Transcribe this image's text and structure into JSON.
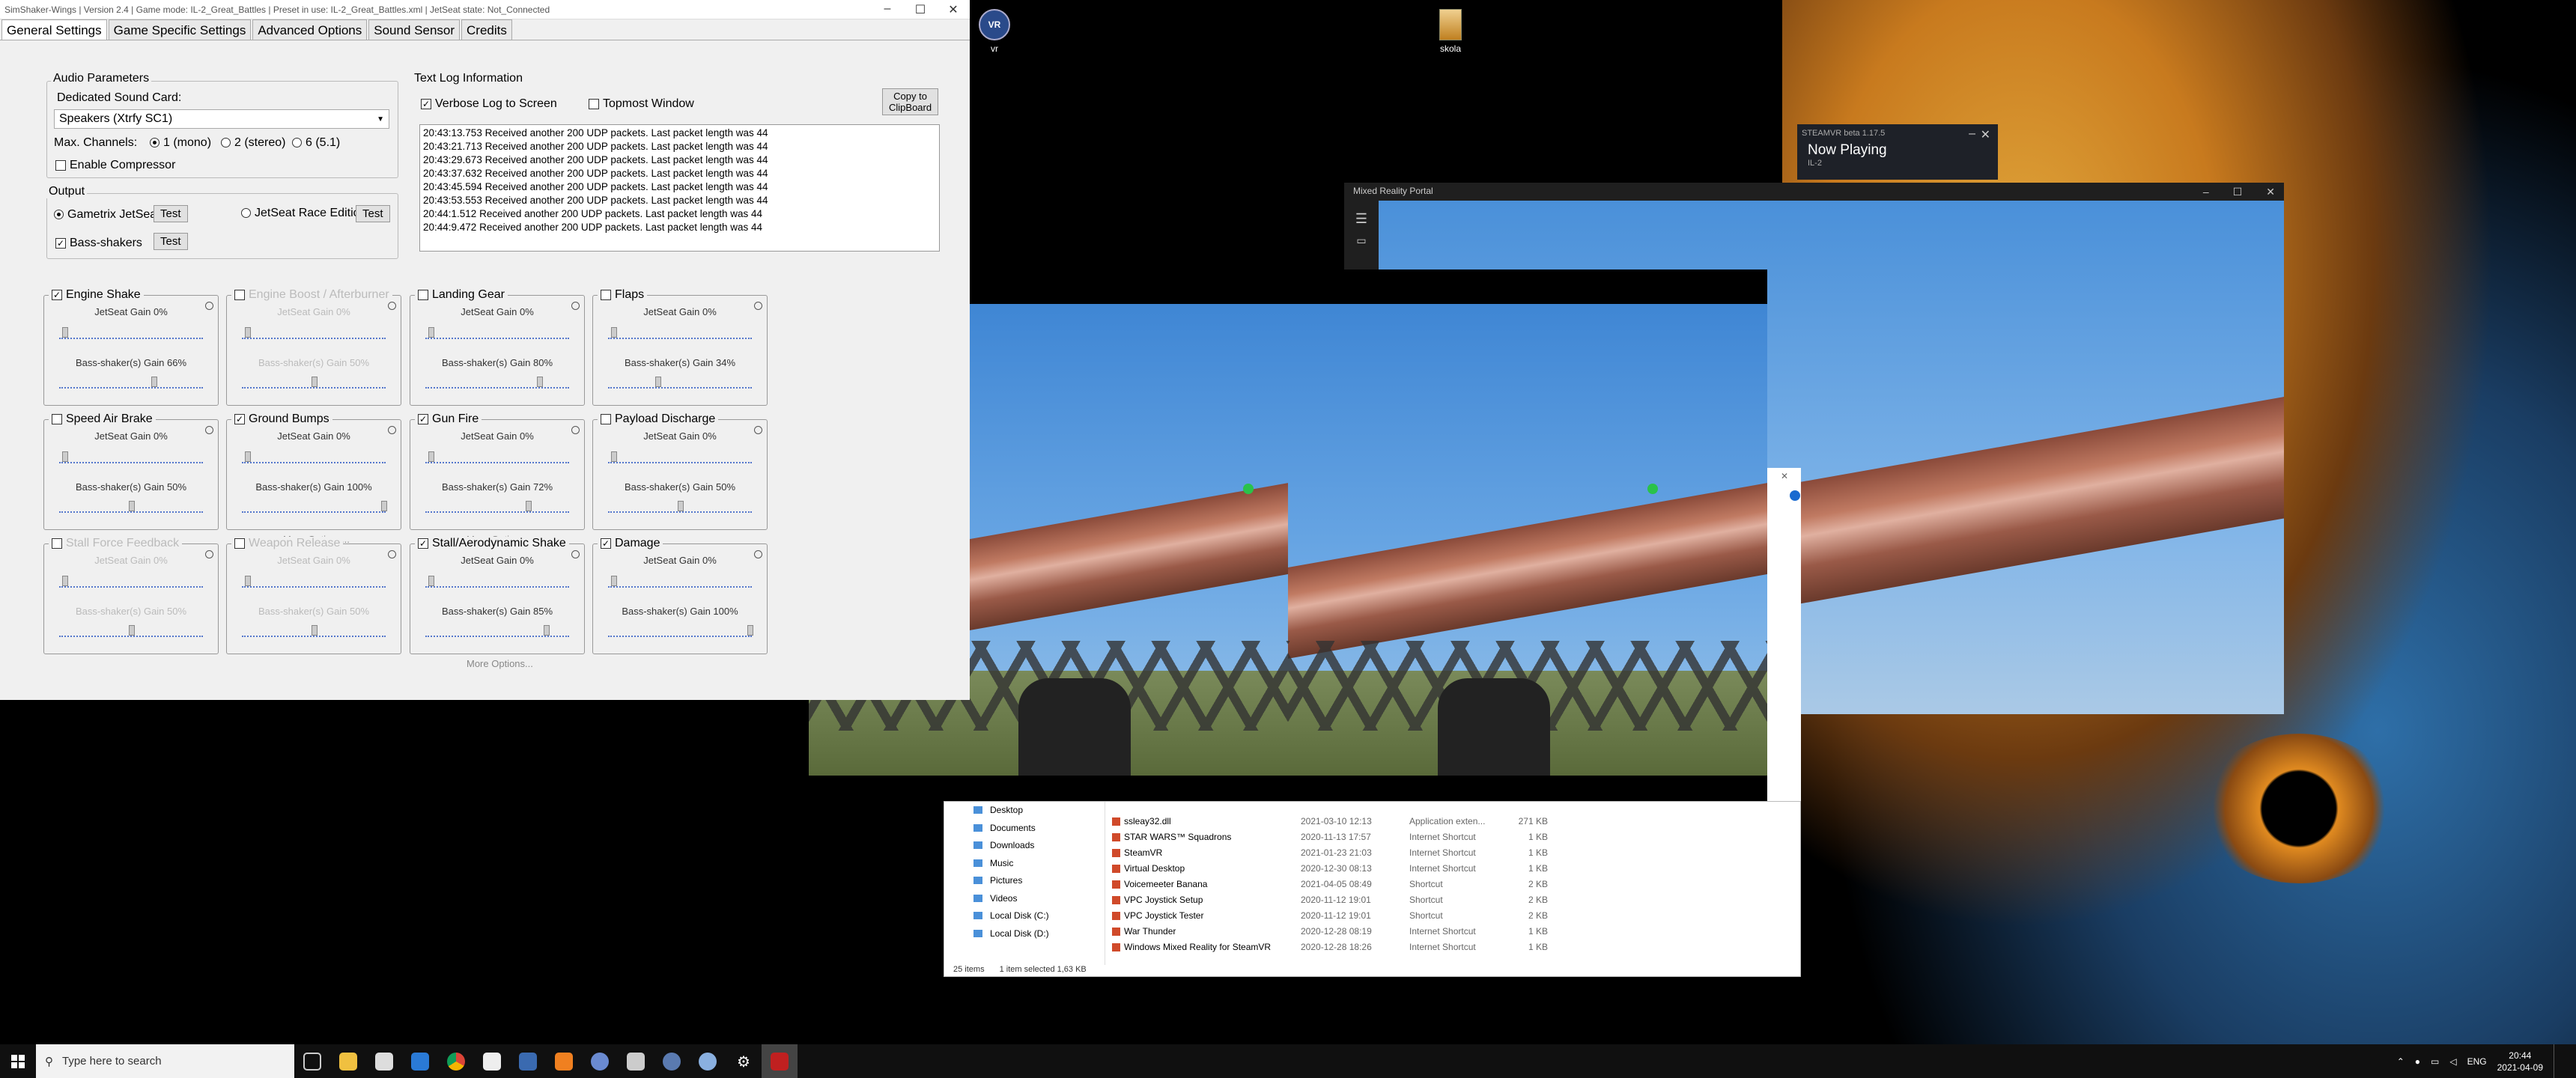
{
  "desktop": {
    "icons": [
      {
        "label": "vr"
      },
      {
        "label": "skola"
      }
    ]
  },
  "simshaker": {
    "title": "SimShaker-Wings | Version 2.4 | Game mode: IL-2_Great_Battles | Preset in use: IL-2_Great_Battles.xml | JetSeat state: Not_Connected",
    "tabs": [
      "General Settings",
      "Game Specific Settings",
      "Advanced Options",
      "Sound Sensor",
      "Credits"
    ],
    "audio": {
      "group_title": "Audio Parameters",
      "sound_card_label": "Dedicated Sound Card:",
      "sound_card_value": "Speakers (Xtrfy SC1)",
      "max_channels_label": "Max. Channels:",
      "channel_options": [
        "1 (mono)",
        "2 (stereo)",
        "6 (5.1)"
      ],
      "compressor_label": "Enable Compressor"
    },
    "output": {
      "group_title": "Output",
      "gametrix_label": "Gametrix JetSeat",
      "race_label": "JetSeat Race Edition",
      "bass_label": "Bass-shakers",
      "test_label": "Test"
    },
    "log": {
      "group_title": "Text Log Information",
      "verbose_label": "Verbose Log to Screen",
      "topmost_label": "Topmost Window",
      "copy_label_1": "Copy to",
      "copy_label_2": "ClipBoard",
      "lines": [
        "20:43:13.753 Received another 200 UDP packets. Last packet length was 44",
        "20:43:21.713 Received another 200 UDP packets. Last packet length was 44",
        "20:43:29.673 Received another 200 UDP packets. Last packet length was 44",
        "20:43:37.632 Received another 200 UDP packets. Last packet length was 44",
        "20:43:45.594 Received another 200 UDP packets. Last packet length was 44",
        "20:43:53.553 Received another 200 UDP packets. Last packet length was 44",
        "20:44:1.512 Received another 200 UDP packets. Last packet length was 44",
        "20:44:9.472 Received another 200 UDP packets. Last packet length was 44"
      ]
    },
    "effects": [
      {
        "name": "Engine Shake",
        "checked": true,
        "enabled": true,
        "jetseat": "JetSeat Gain 0%",
        "bass": "Bass-shaker(s) Gain 66%",
        "bass_level": 0.66
      },
      {
        "name": "Engine Boost / Afterburner",
        "checked": false,
        "enabled": false,
        "jetseat": "JetSeat Gain 0%",
        "bass": "Bass-shaker(s) Gain 50%",
        "bass_level": 0.5
      },
      {
        "name": "Landing Gear",
        "checked": false,
        "enabled": true,
        "jetseat": "JetSeat Gain 0%",
        "bass": "Bass-shaker(s) Gain 80%",
        "bass_level": 0.8
      },
      {
        "name": "Flaps",
        "checked": false,
        "enabled": true,
        "jetseat": "JetSeat Gain 0%",
        "bass": "Bass-shaker(s) Gain 34%",
        "bass_level": 0.34
      },
      {
        "name": "Speed Air Brake",
        "checked": false,
        "enabled": true,
        "jetseat": "JetSeat Gain 0%",
        "bass": "Bass-shaker(s) Gain 50%",
        "bass_level": 0.5
      },
      {
        "name": "Ground Bumps",
        "checked": true,
        "enabled": true,
        "jetseat": "JetSeat Gain 0%",
        "bass": "Bass-shaker(s) Gain 100%",
        "bass_level": 1.0,
        "more": "More Options..."
      },
      {
        "name": "Gun Fire",
        "checked": true,
        "enabled": true,
        "jetseat": "JetSeat Gain 0%",
        "bass": "Bass-shaker(s) Gain 72%",
        "bass_level": 0.72,
        "more": "More Options..."
      },
      {
        "name": "Payload Discharge",
        "checked": false,
        "enabled": true,
        "jetseat": "JetSeat Gain 0%",
        "bass": "Bass-shaker(s) Gain 50%",
        "bass_level": 0.5
      },
      {
        "name": "Stall Force Feedback",
        "checked": false,
        "enabled": false,
        "jetseat": "JetSeat Gain 0%",
        "bass": "Bass-shaker(s) Gain 50%",
        "bass_level": 0.5
      },
      {
        "name": "Weapon Release",
        "checked": false,
        "enabled": false,
        "jetseat": "JetSeat Gain 0%",
        "bass": "Bass-shaker(s) Gain 50%",
        "bass_level": 0.5
      },
      {
        "name": "Stall/Aerodynamic Shake",
        "checked": true,
        "enabled": true,
        "jetseat": "JetSeat Gain 0%",
        "bass": "Bass-shaker(s) Gain 85%",
        "bass_level": 0.85,
        "more": "More Options..."
      },
      {
        "name": "Damage",
        "checked": true,
        "enabled": true,
        "jetseat": "JetSeat Gain 0%",
        "bass": "Bass-shaker(s) Gain 100%",
        "bass_level": 1.0
      }
    ]
  },
  "steamvr": {
    "title": "STEAMVR beta 1.17.5",
    "heading": "Now Playing",
    "sub": "IL-2"
  },
  "mrp": {
    "title": "Mixed Reality Portal"
  },
  "explorer": {
    "nav": [
      "Desktop",
      "Documents",
      "Downloads",
      "Music",
      "Pictures",
      "Videos",
      "Local Disk (C:)",
      "Local Disk (D:)"
    ],
    "rows": [
      {
        "name": "ssleay32.dll",
        "date": "2021-03-10 12:13",
        "type": "Application exten...",
        "size": "271 KB"
      },
      {
        "name": "STAR WARS™ Squadrons",
        "date": "2020-11-13 17:57",
        "type": "Internet Shortcut",
        "size": "1 KB"
      },
      {
        "name": "SteamVR",
        "date": "2021-01-23 21:03",
        "type": "Internet Shortcut",
        "size": "1 KB"
      },
      {
        "name": "Virtual Desktop",
        "date": "2020-12-30 08:13",
        "type": "Internet Shortcut",
        "size": "1 KB"
      },
      {
        "name": "Voicemeeter Banana",
        "date": "2021-04-05 08:49",
        "type": "Shortcut",
        "size": "2 KB"
      },
      {
        "name": "VPC Joystick Setup",
        "date": "2020-11-12 19:01",
        "type": "Shortcut",
        "size": "2 KB"
      },
      {
        "name": "VPC Joystick Tester",
        "date": "2020-11-12 19:01",
        "type": "Shortcut",
        "size": "2 KB"
      },
      {
        "name": "War Thunder",
        "date": "2020-12-28 08:19",
        "type": "Internet Shortcut",
        "size": "1 KB"
      },
      {
        "name": "Windows Mixed Reality for SteamVR",
        "date": "2020-12-28 18:26",
        "type": "Internet Shortcut",
        "size": "1 KB"
      }
    ],
    "status_items": "25 items",
    "status_selected": "1 item selected  1,63 KB"
  },
  "taskbar": {
    "search_placeholder": "Type here to search",
    "lang": "ENG",
    "time": "20:44",
    "date": "2021-04-09"
  }
}
